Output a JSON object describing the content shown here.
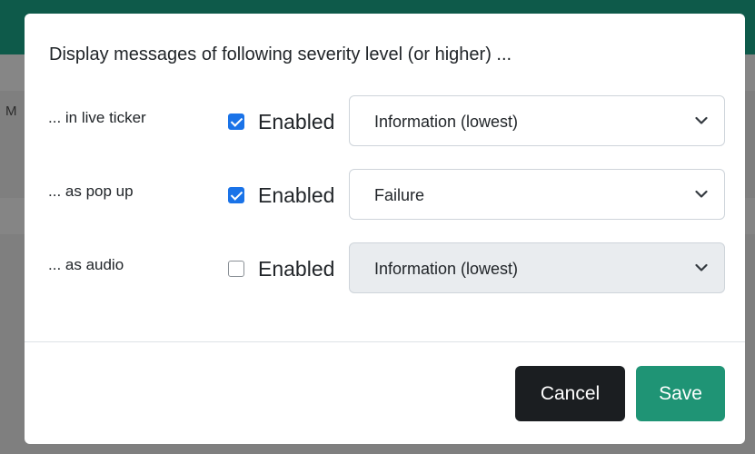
{
  "background": {
    "partial_text": "M"
  },
  "dialog": {
    "title": "Display messages of following severity level (or higher) ...",
    "rows": [
      {
        "label": "... in live ticker",
        "enabled": true,
        "enabled_label": "Enabled",
        "selected": "Information (lowest)",
        "disabled": false
      },
      {
        "label": "... as pop up",
        "enabled": true,
        "enabled_label": "Enabled",
        "selected": "Failure",
        "disabled": false
      },
      {
        "label": "... as audio",
        "enabled": false,
        "enabled_label": "Enabled",
        "selected": "Information (lowest)",
        "disabled": true
      }
    ],
    "buttons": {
      "cancel": "Cancel",
      "save": "Save"
    }
  },
  "colors": {
    "header_bar": "#0e5a4a",
    "checkbox_checked": "#1a73e8",
    "cancel_button": "#1b1e21",
    "save_button": "#1f9475",
    "disabled_select": "#e9ecef"
  },
  "icons": {
    "select_arrow": "chevron-down-icon",
    "checkbox_mark": "check-icon"
  }
}
